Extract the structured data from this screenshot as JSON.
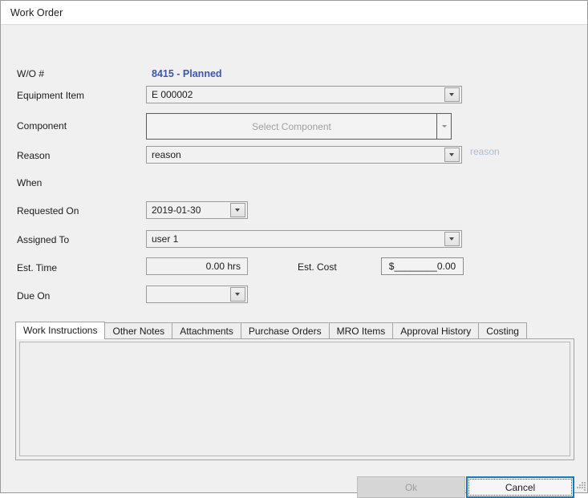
{
  "window": {
    "title": "Work Order"
  },
  "form": {
    "wo_number_label": "W/O #",
    "wo_number_value": "8415 - Planned",
    "wo_number_color": "#3b55b5",
    "equipment_label": "Equipment Item",
    "equipment_value": "E 000002",
    "component_label": "Component",
    "component_placeholder": "Select Component",
    "reason_label": "Reason",
    "reason_value": "reason",
    "reason_side_link": "reason",
    "when_label": "When",
    "requested_on_label": "Requested On",
    "requested_on_value": "2019-01-30",
    "assigned_to_label": "Assigned To",
    "assigned_to_value": "user 1",
    "est_time_label": "Est. Time",
    "est_time_value": "0.00 hrs",
    "est_cost_label": "Est. Cost",
    "est_cost_value": "$________0.00",
    "due_on_label": "Due On",
    "due_on_value": ""
  },
  "tabs": [
    {
      "label": "Work Instructions",
      "active": true
    },
    {
      "label": "Other Notes",
      "active": false
    },
    {
      "label": "Attachments",
      "active": false
    },
    {
      "label": "Purchase Orders",
      "active": false
    },
    {
      "label": "MRO Items",
      "active": false
    },
    {
      "label": "Approval History",
      "active": false
    },
    {
      "label": "Costing",
      "active": false
    }
  ],
  "tab_content": {
    "work_instructions_text": ""
  },
  "footer": {
    "ok_label": "Ok",
    "cancel_label": "Cancel"
  },
  "icons": {
    "dropdown": "chevron-down-icon",
    "resize": "resize-grip-icon"
  }
}
